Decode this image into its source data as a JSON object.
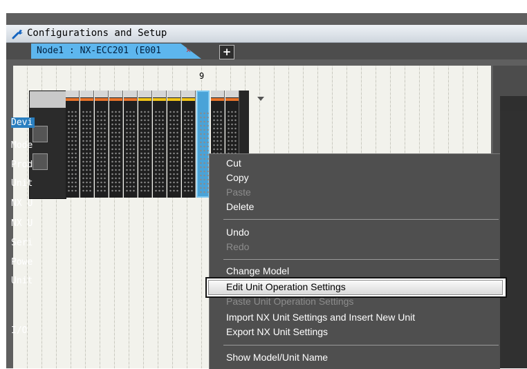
{
  "window": {
    "title": "Configurations and Setup"
  },
  "tabs": {
    "active_label": "Node1 : NX-ECC201 (E001",
    "close_glyph": "✕",
    "add_glyph": "+"
  },
  "rack": {
    "selected_slot_number": "9"
  },
  "right_panel": {
    "items": [
      "Devi",
      "Mode",
      "Prod",
      "Unit",
      "NX U",
      "NX U",
      "Seri",
      "Powe",
      "Unit",
      "I/O"
    ]
  },
  "context_menu": {
    "items": [
      {
        "label": "Cut",
        "enabled": true
      },
      {
        "label": "Copy",
        "enabled": true
      },
      {
        "label": "Paste",
        "enabled": false
      },
      {
        "label": "Delete",
        "enabled": true
      },
      {
        "label": "Undo",
        "enabled": true
      },
      {
        "label": "Redo",
        "enabled": false
      },
      {
        "label": "Change Model",
        "enabled": true
      },
      {
        "label": "Edit Unit Operation Settings",
        "enabled": true,
        "highlighted": true
      },
      {
        "label": "Paste Unit Operation Settings",
        "enabled": false
      },
      {
        "label": "Import NX Unit Settings and Insert New Unit",
        "enabled": true
      },
      {
        "label": "Export NX Unit Settings",
        "enabled": true
      },
      {
        "label": "Show Model/Unit Name",
        "enabled": true
      }
    ]
  },
  "colors": {
    "tab_active": "#5db6ee",
    "selected_unit": "#4aa3d8",
    "menu_bg": "#4f4f4f",
    "right_highlight": "#2a7fc0"
  }
}
